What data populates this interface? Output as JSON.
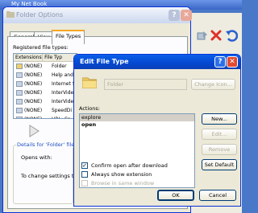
{
  "background": {
    "explorer_title": "My Net Book",
    "toolbar_icons": [
      "move-to-icon",
      "delete-icon",
      "undo-icon"
    ]
  },
  "folder_options": {
    "title": "Folder Options",
    "tabs": [
      "General",
      "View",
      "File Types"
    ],
    "active_tab": "File Types",
    "registered_label": "Registered file types:",
    "columns": [
      "Extensions",
      "File Typ"
    ],
    "rows": [
      {
        "ext": "(NONE)",
        "type": "Folder"
      },
      {
        "ext": "(NONE)",
        "type": "Help and"
      },
      {
        "ext": "(NONE)",
        "type": "Internet S"
      },
      {
        "ext": "(NONE)",
        "type": "InterVide"
      },
      {
        "ext": "(NONE)",
        "type": "InterVide"
      },
      {
        "ext": "(NONE)",
        "type": "SpeedDi"
      },
      {
        "ext": "(NONE)",
        "type": "URL: Ca"
      }
    ],
    "details_label": "Details for 'Folder' file ty",
    "opens_with_label": "Opens with:",
    "change_settings_text": "To change settings tha"
  },
  "edit_file_type": {
    "title": "Edit File Type",
    "folder_name": "Folder",
    "change_icon_label": "Change Icon...",
    "actions_label": "Actions:",
    "actions": [
      {
        "label": "explore",
        "selected": true,
        "default": false
      },
      {
        "label": "open",
        "selected": false,
        "default": true
      }
    ],
    "buttons": {
      "new": "New...",
      "edit": "Edit...",
      "remove": "Remove",
      "set_default": "Set Default",
      "ok": "OK",
      "cancel": "Cancel"
    },
    "checkboxes": [
      {
        "label": "Confirm open after download",
        "checked": true,
        "enabled": true
      },
      {
        "label": "Always show extension",
        "checked": false,
        "enabled": true
      },
      {
        "label": "Browse in same window",
        "checked": false,
        "enabled": false
      }
    ]
  },
  "colors": {
    "xp_title_blue": "#0548d0",
    "dialog_face": "#ece9d8",
    "close_red": "#e34a2f",
    "tab_highlight": "#f5a623",
    "folder_yellow": "#f0d068"
  }
}
